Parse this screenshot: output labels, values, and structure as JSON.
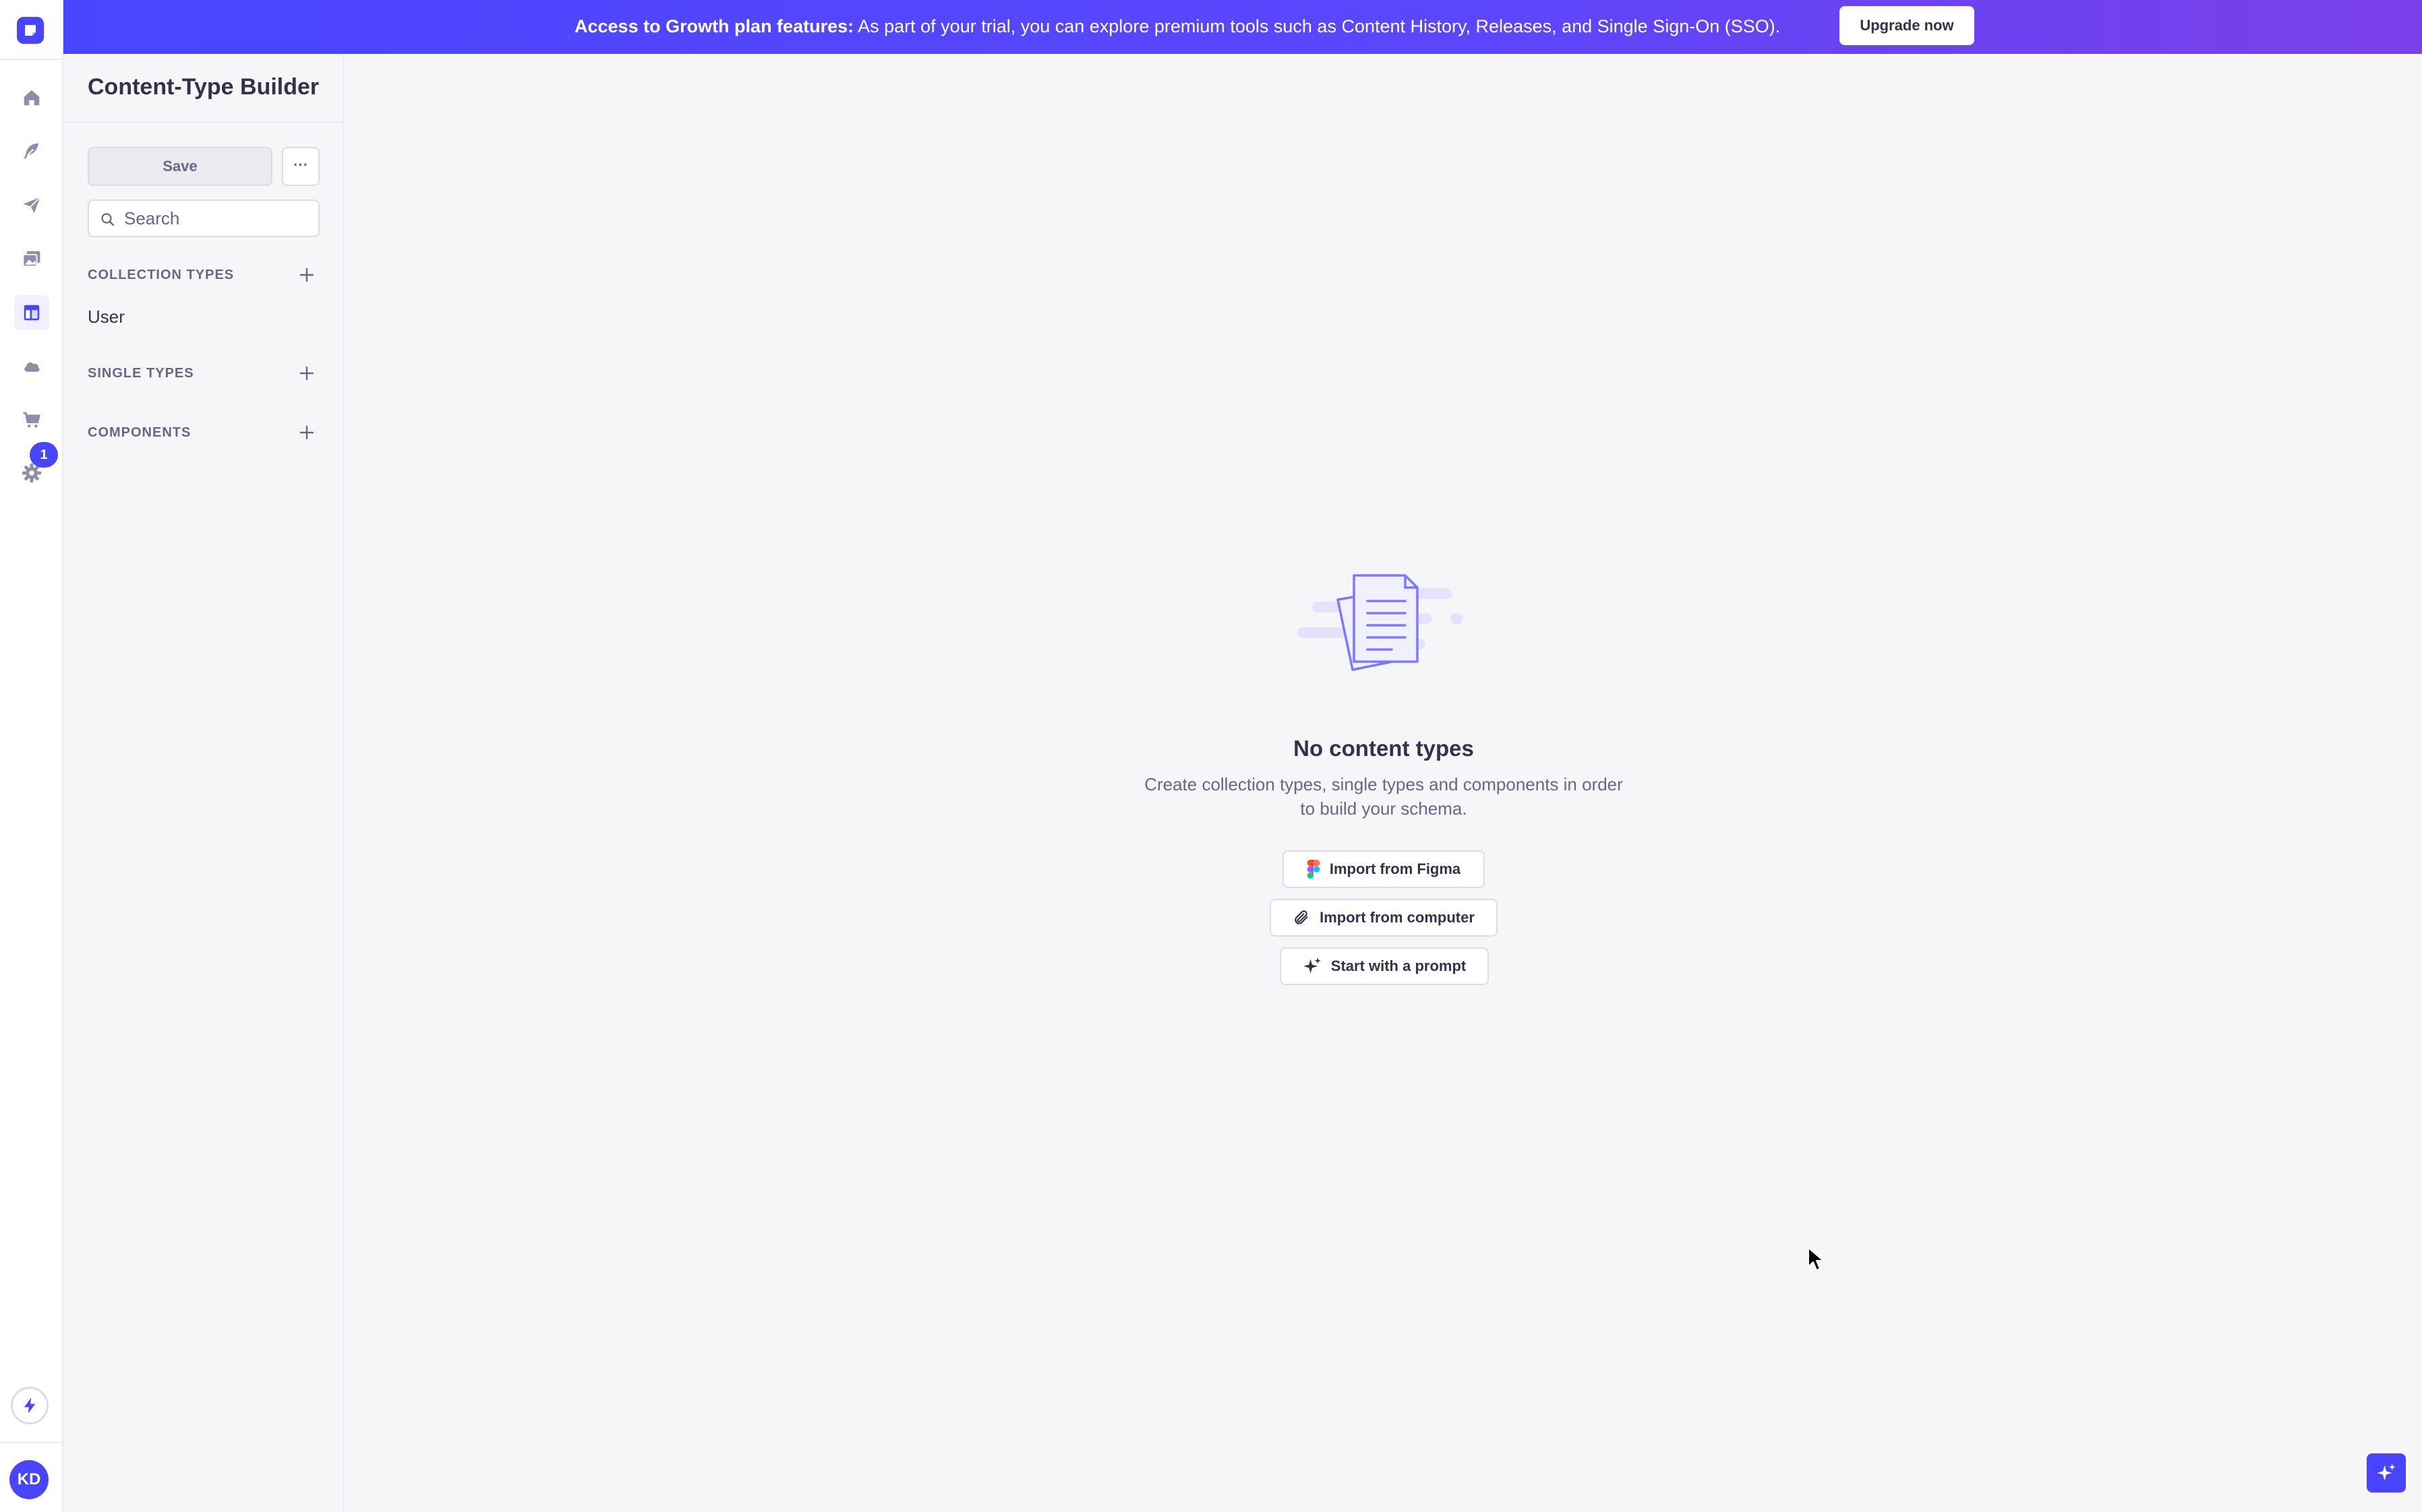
{
  "banner": {
    "bold_text": "Access to Growth plan features:",
    "text": " As part of your trial, you can explore premium tools such as Content History, Releases, and Single Sign-On (SSO).",
    "button_label": "Upgrade now"
  },
  "rail": {
    "items": [
      {
        "icon": "house-icon",
        "active": false
      },
      {
        "icon": "feather-icon",
        "active": false
      },
      {
        "icon": "paper-plane-icon",
        "active": false
      },
      {
        "icon": "images-icon",
        "active": false
      },
      {
        "icon": "layout-icon",
        "active": true
      },
      {
        "icon": "cloud-icon",
        "active": false
      },
      {
        "icon": "cart-icon",
        "active": false
      },
      {
        "icon": "gear-icon",
        "active": false
      }
    ],
    "settings_badge": "1",
    "avatar_initials": "KD"
  },
  "sidenav": {
    "title": "Content-Type Builder",
    "save_label": "Save",
    "more_label": "···",
    "search_placeholder": "Search",
    "collection_types_label": "Collection types",
    "collection_types": [
      "User"
    ],
    "single_types_label": "Single types",
    "components_label": "Components"
  },
  "empty_state": {
    "title": "No content types",
    "description_line1": "Create collection types, single types and components in order",
    "description_line2": "to build your schema.",
    "actions": [
      "Import from Figma",
      "Import from computer",
      "Start with a prompt"
    ]
  },
  "colors": {
    "primary": "#4945ff",
    "banner_end": "#7b3fe8",
    "text": "#32324d",
    "muted": "#666687",
    "background": "#f6f6f9",
    "border": "#dcdce4"
  }
}
